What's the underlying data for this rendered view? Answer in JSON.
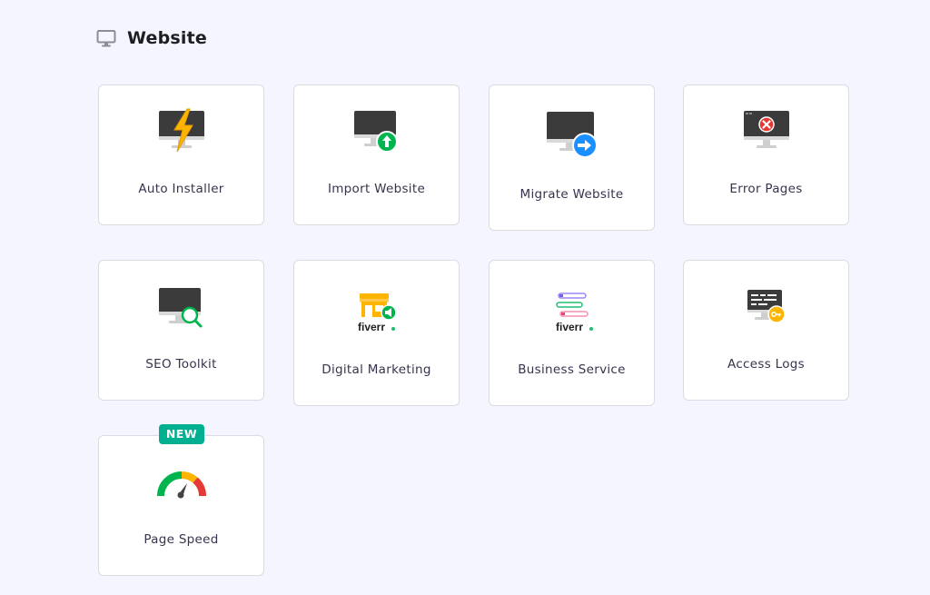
{
  "section": {
    "title": "Website",
    "icon": "monitor-icon"
  },
  "cards": [
    {
      "label": "Auto Installer",
      "icon": "lightning-monitor-icon"
    },
    {
      "label": "Import Website",
      "icon": "import-upload-monitor-icon"
    },
    {
      "label": "Migrate Website",
      "icon": "migrate-arrow-monitor-icon"
    },
    {
      "label": "Error Pages",
      "icon": "error-x-monitor-icon"
    },
    {
      "label": "SEO Toolkit",
      "icon": "magnifier-monitor-icon"
    },
    {
      "label": "Digital Marketing",
      "icon": "fiverr-storefront-icon",
      "logo_text": "fiverr"
    },
    {
      "label": "Business Service",
      "icon": "fiverr-list-icon",
      "logo_text": "fiverr"
    },
    {
      "label": "Access Logs",
      "icon": "key-monitor-icon"
    },
    {
      "label": "Page Speed",
      "icon": "speedometer-icon",
      "badge": "NEW"
    }
  ],
  "colors": {
    "background": "#f4f5ff",
    "card_border": "#dadce0",
    "monitor_dark": "#3b3b3b",
    "lightning": "#ffb400",
    "green": "#00b54f",
    "blue": "#1a8fff",
    "red": "#e53935",
    "badge": "#00b090",
    "fiverr_green": "#1dbf73"
  }
}
